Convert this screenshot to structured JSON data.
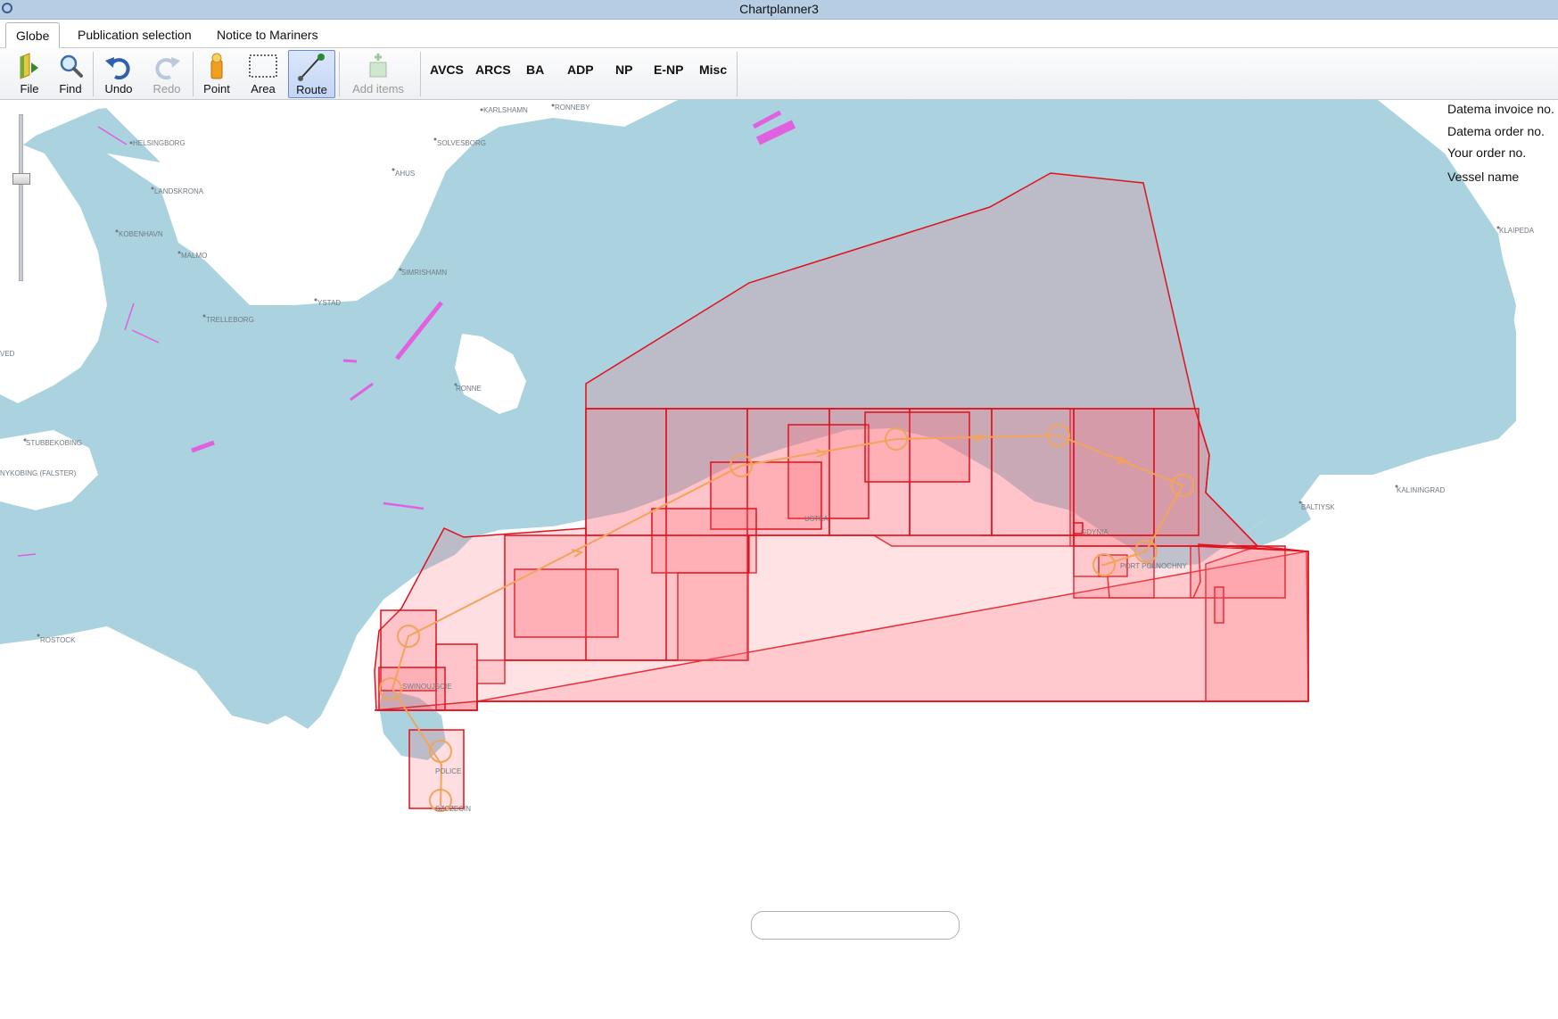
{
  "window": {
    "title": "Chartplanner3"
  },
  "tabs": [
    {
      "label": "Globe",
      "active": true
    },
    {
      "label": "Publication selection",
      "active": false
    },
    {
      "label": "Notice to Mariners",
      "active": false
    }
  ],
  "toolbar": {
    "file": "File",
    "find": "Find",
    "undo": "Undo",
    "redo": "Redo",
    "point": "Point",
    "area": "Area",
    "route": "Route",
    "add_items": "Add items",
    "publications": [
      "AVCS",
      "ARCS",
      "BA",
      "ADP",
      "NP",
      "E-NP",
      "Misc"
    ]
  },
  "info_panel": {
    "invoice": "Datema invoice no.",
    "order": "Datema order no.",
    "your_order": "Your order no.",
    "vessel": "Vessel name"
  },
  "map": {
    "cities": {
      "helsingborg": "HELSINGBORG",
      "karlshamn": "KARLSHAMN",
      "ronneby": "RONNEBY",
      "solvesborg": "SOLVESBORG",
      "ahus": "AHUS",
      "landskrona": "LANDSKRONA",
      "kobenhavn": "KOBENHAVN",
      "malmo": "MALMO",
      "simrishamn": "SIMRISHAMN",
      "ystad": "YSTAD",
      "trelleborg": "TRELLEBORG",
      "ronne": "RONNE",
      "stubbekobing": "STUBBEKOBING",
      "nykobing": "NYKOBING (FALSTER)",
      "rostock": "ROSTOCK",
      "klaipeda": "KLAIPEDA",
      "kaliningrad": "KALININGRAD",
      "baltiysk": "BALTIYSK",
      "gdynia": "GDYNIA",
      "port_polnochny": "PORT POLNOCHNY",
      "ustka": "USTKA",
      "swinoujscie": "SWINOUJSCIE",
      "police": "POLICE",
      "szczecin": "SZCZECIN",
      "ved": "VED"
    },
    "colors": {
      "sea": "#aad3df",
      "land": "#ffffff",
      "coverage_fill": "#ff6b78",
      "coverage_stroke": "#e0101c",
      "route": "#f2a45a",
      "traffic_zone": "#e060e0"
    }
  }
}
